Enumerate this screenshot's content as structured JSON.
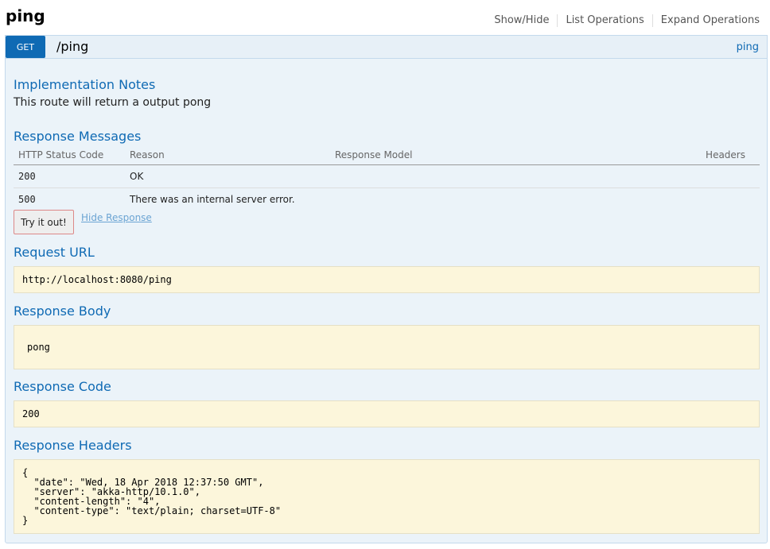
{
  "resource": {
    "title": "ping",
    "links": [
      "Show/Hide",
      "List Operations",
      "Expand Operations"
    ]
  },
  "operation": {
    "method": "GET",
    "path": "/ping",
    "tag": "ping"
  },
  "implementation_notes": {
    "heading": "Implementation Notes",
    "text": "This route will return a output pong"
  },
  "response_messages": {
    "heading": "Response Messages",
    "columns": [
      "HTTP Status Code",
      "Reason",
      "Response Model",
      "Headers"
    ],
    "rows": [
      {
        "code": "200",
        "reason": "OK"
      },
      {
        "code": "500",
        "reason": "There was an internal server error."
      }
    ]
  },
  "actions": {
    "try_label": "Try it out!",
    "hide_label": "Hide Response"
  },
  "request_url": {
    "heading": "Request URL",
    "value": "http://localhost:8080/ping"
  },
  "response_body": {
    "heading": "Response Body",
    "value": "pong"
  },
  "response_code": {
    "heading": "Response Code",
    "value": "200"
  },
  "response_headers": {
    "heading": "Response Headers",
    "value": "{\n  \"date\": \"Wed, 18 Apr 2018 12:37:50 GMT\",\n  \"server\": \"akka-http/10.1.0\",\n  \"content-length\": \"4\",\n  \"content-type\": \"text/plain; charset=UTF-8\"\n}"
  },
  "colors": {
    "method_get": "#0f6ab4",
    "panel_bg": "#ebf3f9",
    "code_bg": "#fcf6db",
    "heading": "#0f6ab4"
  }
}
